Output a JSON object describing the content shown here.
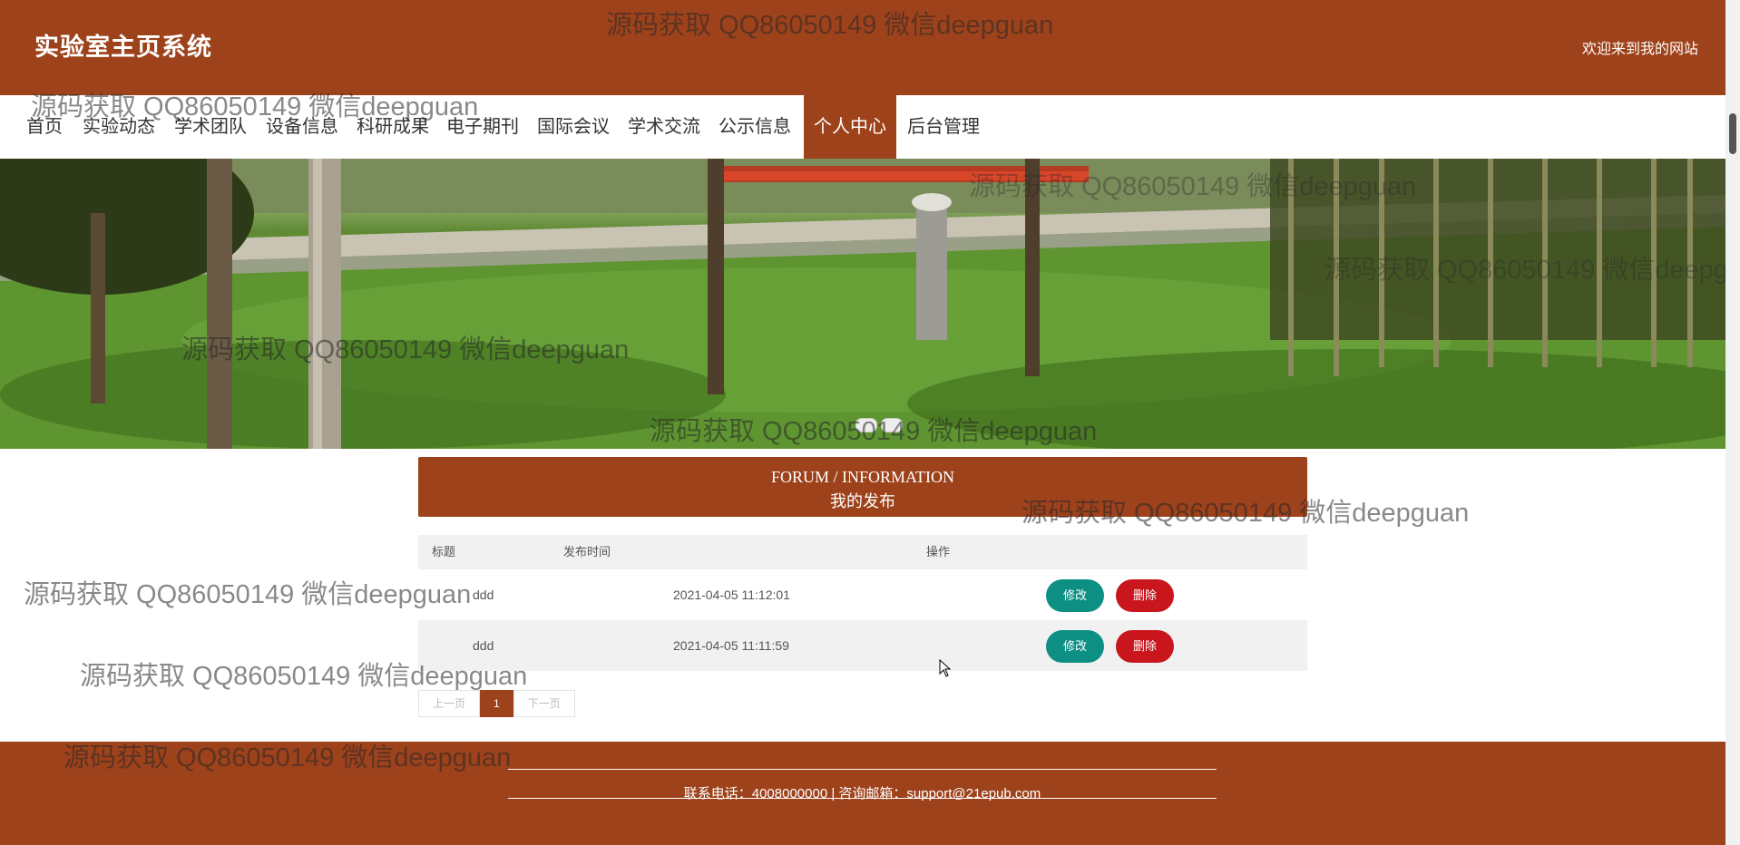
{
  "header": {
    "site_title": "实验室主页系统",
    "welcome": "欢迎来到我的网站"
  },
  "nav": {
    "items": [
      {
        "label": "首页"
      },
      {
        "label": "实验动态"
      },
      {
        "label": "学术团队"
      },
      {
        "label": "设备信息"
      },
      {
        "label": "科研成果"
      },
      {
        "label": "电子期刊"
      },
      {
        "label": "国际会议"
      },
      {
        "label": "学术交流"
      },
      {
        "label": "公示信息"
      },
      {
        "label": "个人中心"
      },
      {
        "label": "后台管理"
      }
    ],
    "active": "个人中心"
  },
  "section": {
    "title_en": "FORUM / INFORMATION",
    "title_cn": "我的发布"
  },
  "table": {
    "headers": [
      "标题",
      "发布时间",
      "操作"
    ],
    "rows": [
      {
        "title": "ddd",
        "time": "2021-04-05 11:12:01",
        "edit": "修改",
        "delete": "删除"
      },
      {
        "title": "ddd",
        "time": "2021-04-05 11:11:59",
        "edit": "修改",
        "delete": "删除"
      }
    ]
  },
  "pager": {
    "prev": "上一页",
    "current": "1",
    "next": "下一页"
  },
  "footer": {
    "contact": "联系电话：4008000000 | 咨询邮箱：support@21epub.com"
  },
  "watermark": "源码获取 QQ86050149 微信deepguan",
  "colors": {
    "brand": "#9e421b",
    "edit_button": "#0e8f84",
    "delete_button": "#c9151c"
  }
}
